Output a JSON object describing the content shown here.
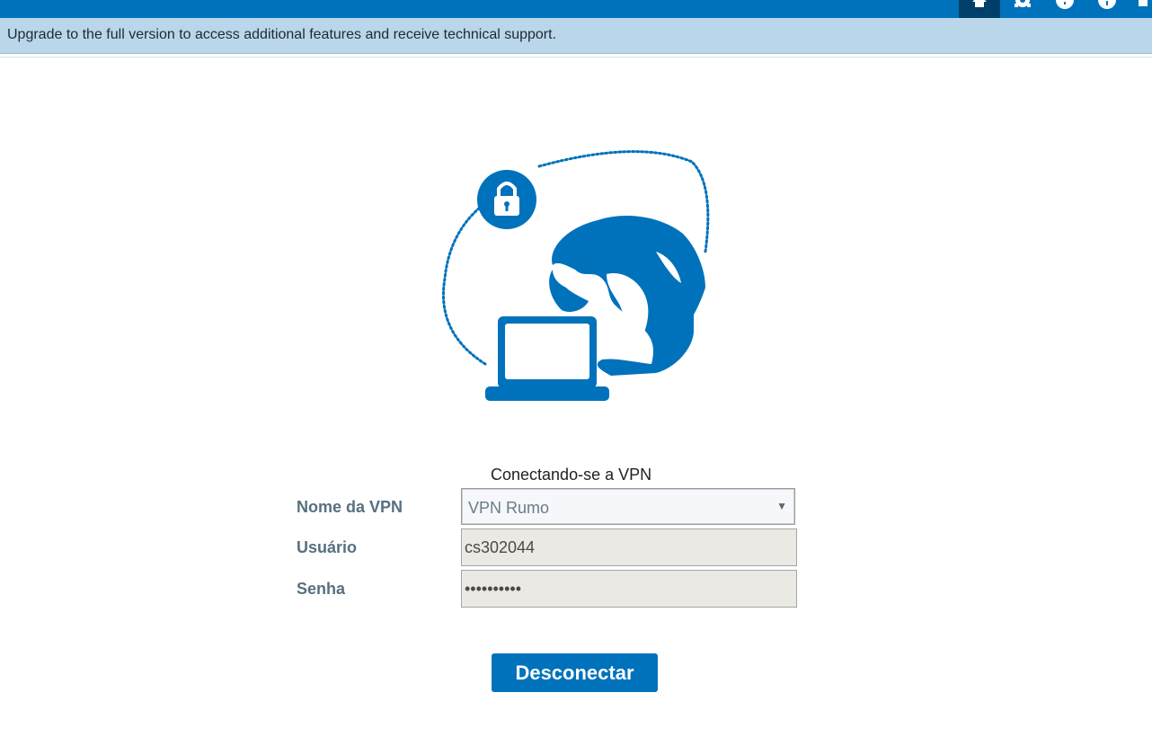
{
  "banner": {
    "text": "Upgrade to the full version to access additional features and receive technical support."
  },
  "nav": {
    "items": [
      {
        "icon": "home-icon",
        "active": true
      },
      {
        "icon": "gear-icon",
        "active": false
      },
      {
        "icon": "alert-icon",
        "active": false
      },
      {
        "icon": "info-icon",
        "active": false
      },
      {
        "icon": "menu-icon",
        "active": false
      }
    ]
  },
  "colors": {
    "brand": "#0072bc",
    "banner_bg": "#bad6eb",
    "nav_active": "#003f6a"
  },
  "form": {
    "status_text": "Conectando-se a VPN",
    "vpn_name_label": "Nome da VPN",
    "vpn_name_value": "VPN Rumo",
    "username_label": "Usuário",
    "username_value": "cs302044",
    "password_label": "Senha",
    "password_value": "••••••••••",
    "disconnect_label": "Desconectar"
  }
}
